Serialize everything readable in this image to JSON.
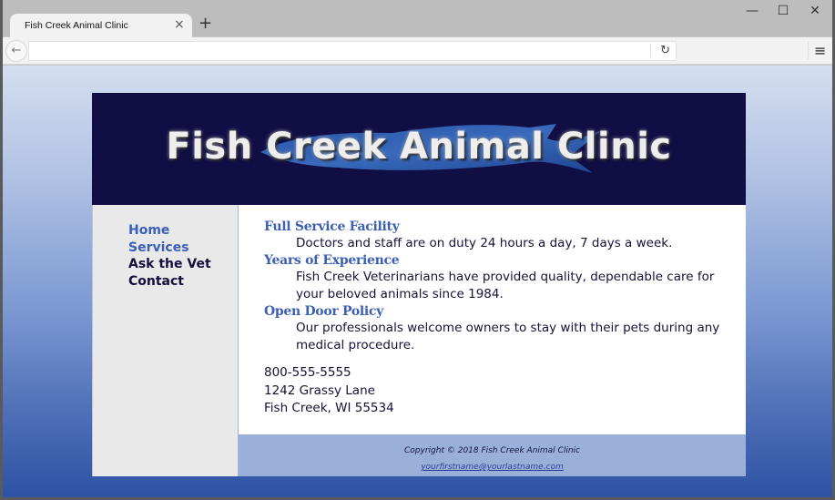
{
  "browser": {
    "tab_title": "Fish Creek Animal Clinic",
    "tab_close_icon": "×",
    "new_tab_icon": "+",
    "minimize_icon": "—",
    "maximize_icon": "☐",
    "close_icon": "✕",
    "back_icon": "←",
    "reload_icon": "↻",
    "menu_icon": "≡",
    "url": ""
  },
  "page": {
    "header_title": "Fish Creek Animal Clinic",
    "nav": [
      {
        "label": "Home",
        "state": "link"
      },
      {
        "label": "Services",
        "state": "link"
      },
      {
        "label": "Ask the Vet",
        "state": "visited"
      },
      {
        "label": "Contact",
        "state": "visited"
      }
    ],
    "sections": [
      {
        "heading": "Full Service Facility",
        "text": "Doctors and staff are on duty 24 hours a day, 7 days a week."
      },
      {
        "heading": "Years of Experience",
        "text": "Fish Creek Veterinarians have provided quality, dependable care for your beloved animals since 1984."
      },
      {
        "heading": "Open Door Policy",
        "text": "Our professionals welcome owners to stay with their pets during any medical procedure."
      }
    ],
    "contact": {
      "phone": "800-555-5555",
      "street": "1242 Grassy Lane",
      "city": "Fish Creek, WI 55534"
    },
    "footer": {
      "copyright": "Copyright © 2018 Fish Creek Animal Clinic",
      "email": "yourfirstname@yourlastname.com"
    },
    "colors": {
      "header_bg": "#110e45",
      "accent": "#3c5fb4",
      "nav_bg": "#e9e9e9",
      "footer_bg": "#9ab0d9"
    }
  }
}
